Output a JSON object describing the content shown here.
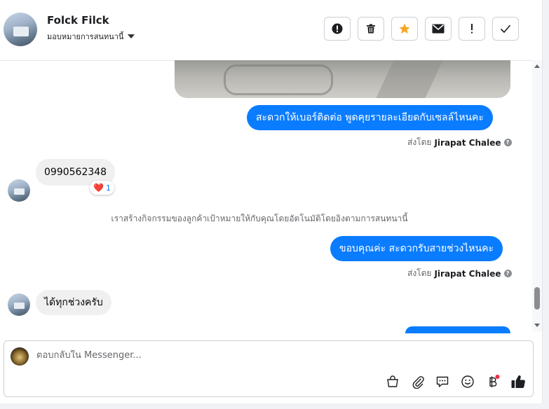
{
  "header": {
    "contact_name": "Folck Filck",
    "assign_label": "มอบหมายการสนทนานี้"
  },
  "messages": {
    "out1_text": "สะดวกให้เบอร์ติดต่อ พูดคุยรายละเอียดกับเซลล์ไหนคะ",
    "sent_by_prefix": "ส่งโดย",
    "sent_by_name": "Jirapat Chalee",
    "in1_text": "0990562348",
    "reaction_emoji": "❤️",
    "reaction_count": "1",
    "system_note": "เราสร้างกิจกรรมของลูกค้าเป้าหมายให้กับคุณโดยอัตโนมัติโดยอิงตามการสนทนานี้",
    "out2_text": "ขอบคุณค่ะ สะดวกรับสายช่วงไหนคะ",
    "in2_text": "ได้ทุกช่วงครับ"
  },
  "composer": {
    "placeholder": "ตอบกลับใน Messenger..."
  },
  "colors": {
    "accent": "#0a7cff",
    "star": "#f5a623",
    "notification_dot": "#f02849"
  }
}
